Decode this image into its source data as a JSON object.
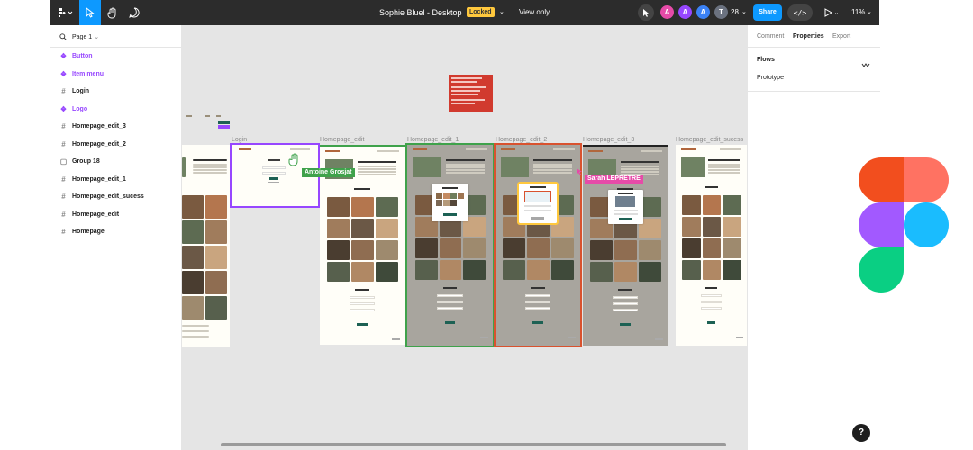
{
  "app": {
    "file_title": "Sophie Bluel - Desktop",
    "locked_label": "Locked",
    "view_mode": "View only",
    "share_label": "Share",
    "zoom": "11%",
    "viewer_count": "28"
  },
  "colors": {
    "toolbar_bg": "#2c2c2c",
    "accent": "#0d99ff",
    "component": "#9747ff",
    "locked": "#ffc83d",
    "canvas": "#e5e5e5",
    "green_frame": "#3fa24b",
    "red_frame": "#d9522e",
    "selection": "#9747ff",
    "note_bg": "#d13a2e",
    "cursor_green": "#3fa24b",
    "cursor_pink": "#e64ba8"
  },
  "avatars": [
    {
      "letter": "A",
      "color": "#e64ba8"
    },
    {
      "letter": "A",
      "color": "#9747ff"
    },
    {
      "letter": "A",
      "color": "#3b82f6"
    },
    {
      "letter": "T",
      "color": "#6b7280"
    }
  ],
  "left_panel": {
    "page_label": "Page 1",
    "layers": [
      {
        "label": "Button",
        "kind": "component"
      },
      {
        "label": "Item menu",
        "kind": "component"
      },
      {
        "label": "Login",
        "kind": "frame"
      },
      {
        "label": "Logo",
        "kind": "component"
      },
      {
        "label": "Homepage_edit_3",
        "kind": "frame"
      },
      {
        "label": "Homepage_edit_2",
        "kind": "frame"
      },
      {
        "label": "Group 18",
        "kind": "group"
      },
      {
        "label": "Homepage_edit_1",
        "kind": "frame"
      },
      {
        "label": "Homepage_edit_sucess",
        "kind": "frame"
      },
      {
        "label": "Homepage_edit",
        "kind": "frame"
      },
      {
        "label": "Homepage",
        "kind": "frame"
      }
    ]
  },
  "canvas": {
    "frame_labels": {
      "login": "Login",
      "edit": "Homepage_edit",
      "edit1": "Homepage_edit_1",
      "edit2": "Homepage_edit_2",
      "edit3": "Homepage_edit_3",
      "success": "Homepage_edit_sucess"
    },
    "cursors": {
      "green": "Antoine Grosjat",
      "pink": "Sarah LEPRETRE"
    }
  },
  "right_panel": {
    "tabs": [
      "Comment",
      "Properties",
      "Export"
    ],
    "flows_label": "Flows",
    "prototype_label": "Prototype"
  },
  "help_label": "?"
}
